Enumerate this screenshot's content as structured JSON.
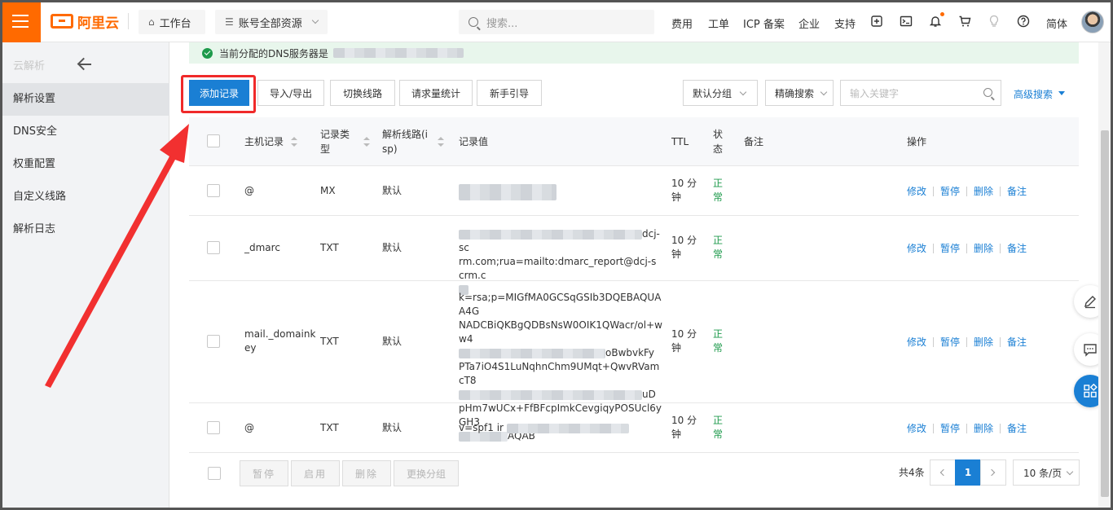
{
  "topbar": {
    "logo_text": "阿里云",
    "workbench": "工作台",
    "resources": "账号全部资源",
    "search_placeholder": "搜索...",
    "links": [
      "费用",
      "工单",
      "ICP 备案",
      "企业",
      "支持"
    ],
    "lang": "简体"
  },
  "sidebar": {
    "title": "云解析",
    "items": [
      "解析设置",
      "DNS安全",
      "权重配置",
      "自定义线路",
      "解析日志"
    ]
  },
  "notice": {
    "text": "当前分配的DNS服务器是"
  },
  "toolbar": {
    "add": "添加记录",
    "import_export": "导入/导出",
    "switch_line": "切换线路",
    "request_stats": "请求量统计",
    "guide": "新手引导",
    "default_group": "默认分组",
    "precise_search": "精确搜索",
    "keyword_placeholder": "输入关键字",
    "advanced": "高级搜索"
  },
  "table": {
    "headers": {
      "host": "主机记录",
      "type_1": "记录类",
      "type_2": "型",
      "line_1": "解析线路(i",
      "line_2": "sp)",
      "value": "记录值",
      "ttl": "TTL",
      "status_1": "状",
      "status_2": "态",
      "remark": "备注",
      "actions": "操作"
    },
    "rows": [
      {
        "host_1": "@",
        "host_2": "",
        "type": "MX",
        "line": "默认",
        "value": [
          ""
        ],
        "ttl_1": "10 分",
        "ttl_2": "钟",
        "status_1": "正",
        "status_2": "常"
      },
      {
        "host_1": "_dmarc",
        "host_2": "",
        "type": "TXT",
        "line": "默认",
        "value": [
          "dcj-sc",
          "rm.com;rua=mailto:dmarc_report@dcj-scrm.c",
          ""
        ],
        "ttl_1": "10 分",
        "ttl_2": "钟",
        "status_1": "正",
        "status_2": "常"
      },
      {
        "host_1": "mail._domaink",
        "host_2": "ey",
        "type": "TXT",
        "line": "默认",
        "value": [
          "k=rsa;p=MIGfMA0GCSqGSIb3DQEBAQUAA4G",
          "NADCBiQKBgQDBsNsW0OIK1QWacr/ol+ww4",
          "oBwbvkFy",
          "PTa7iO4S1LuNqhnChm9UMqt+QwvRVamcT8",
          "uD",
          "pHm7wUCx+FfBFcpImkCevgiqyPOSUcl6yGH3",
          "AQAB"
        ],
        "ttl_1": "10 分",
        "ttl_2": "钟",
        "status_1": "正",
        "status_2": "常"
      },
      {
        "host_1": "@",
        "host_2": "",
        "type": "TXT",
        "line": "默认",
        "value": [
          "v=spf1 ir"
        ],
        "ttl_1": "10 分",
        "ttl_2": "钟",
        "status_1": "正",
        "status_2": "常"
      }
    ],
    "actions": [
      "修改",
      "暂停",
      "删除",
      "备注"
    ]
  },
  "footer": {
    "pause": "暂停",
    "enable": "启用",
    "delete": "删除",
    "change_group": "更换分组",
    "total": "共4条",
    "page": "1",
    "page_size": "10 条/页"
  },
  "colors": {
    "brand": "#ff6a00",
    "primary": "#1a7fd4",
    "success": "#1d9a4b",
    "highlight": "#f02a2a"
  }
}
